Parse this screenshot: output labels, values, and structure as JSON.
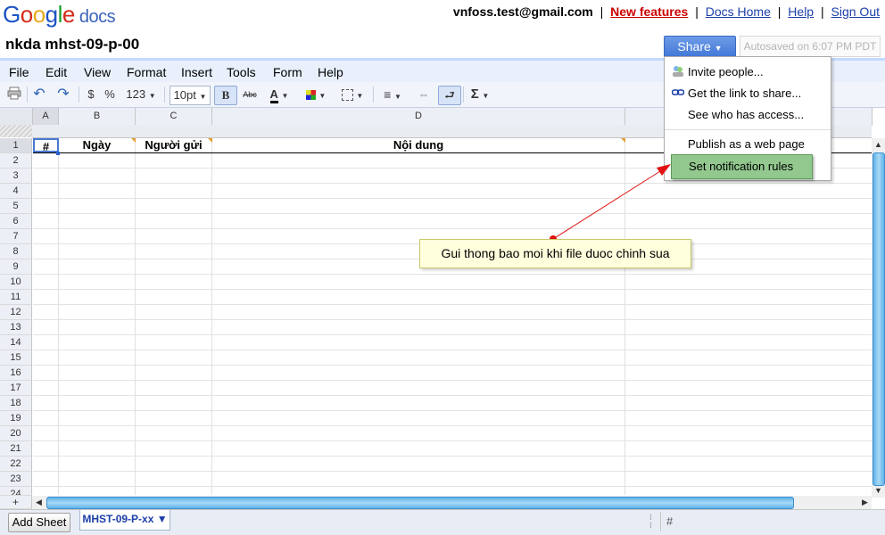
{
  "logo": {
    "text": "Google",
    "product": "docs"
  },
  "header": {
    "email": "vnfoss.test@gmail.com",
    "links": [
      "New features",
      "Docs Home",
      "Help",
      "Sign Out"
    ],
    "separator": "|"
  },
  "document": {
    "title": "nkda mhst-09-p-00",
    "share_label": "Share",
    "autosave": "Autosaved on 6:07 PM PDT"
  },
  "menubar": [
    "File",
    "Edit",
    "View",
    "Format",
    "Insert",
    "Tools",
    "Form",
    "Help"
  ],
  "toolbar": {
    "currency": "$",
    "percent": "%",
    "number_format": "123",
    "font_size": "10pt",
    "bold": "B",
    "strike": "Abc",
    "text_color": "A",
    "sum": "Σ"
  },
  "grid": {
    "columns": [
      "A",
      "B",
      "C",
      "D"
    ],
    "header_row": [
      "#",
      "Ngày",
      "Người gửi",
      "Nội dung"
    ],
    "row_numbers": [
      "1",
      "2",
      "3",
      "4",
      "5",
      "6",
      "7",
      "8",
      "9",
      "10",
      "11",
      "12",
      "13",
      "14",
      "15",
      "16",
      "17",
      "18",
      "19",
      "20",
      "21",
      "22",
      "23",
      "24"
    ],
    "corner": "+"
  },
  "share_menu": {
    "items": [
      {
        "label": "Invite people...",
        "icon": "people-icon"
      },
      {
        "label": "Get the link to share...",
        "icon": "link-icon"
      },
      {
        "label": "See who has access..."
      },
      {
        "label": "Publish as a web page"
      },
      {
        "label": "Set notification rules"
      }
    ]
  },
  "callout": {
    "text": "Gui thong bao moi khi file duoc chinh sua"
  },
  "bottom": {
    "add_sheet": "Add Sheet",
    "sheet_tab": "MHST-09-P-xx ▼",
    "formula_text": "#"
  },
  "colors": {
    "share": "#4479d8",
    "menu_highlight": "#92c88e",
    "callout_bg": "#ffffdd",
    "accent_link": "#1c3fa8",
    "new_features": "#cc0000"
  }
}
